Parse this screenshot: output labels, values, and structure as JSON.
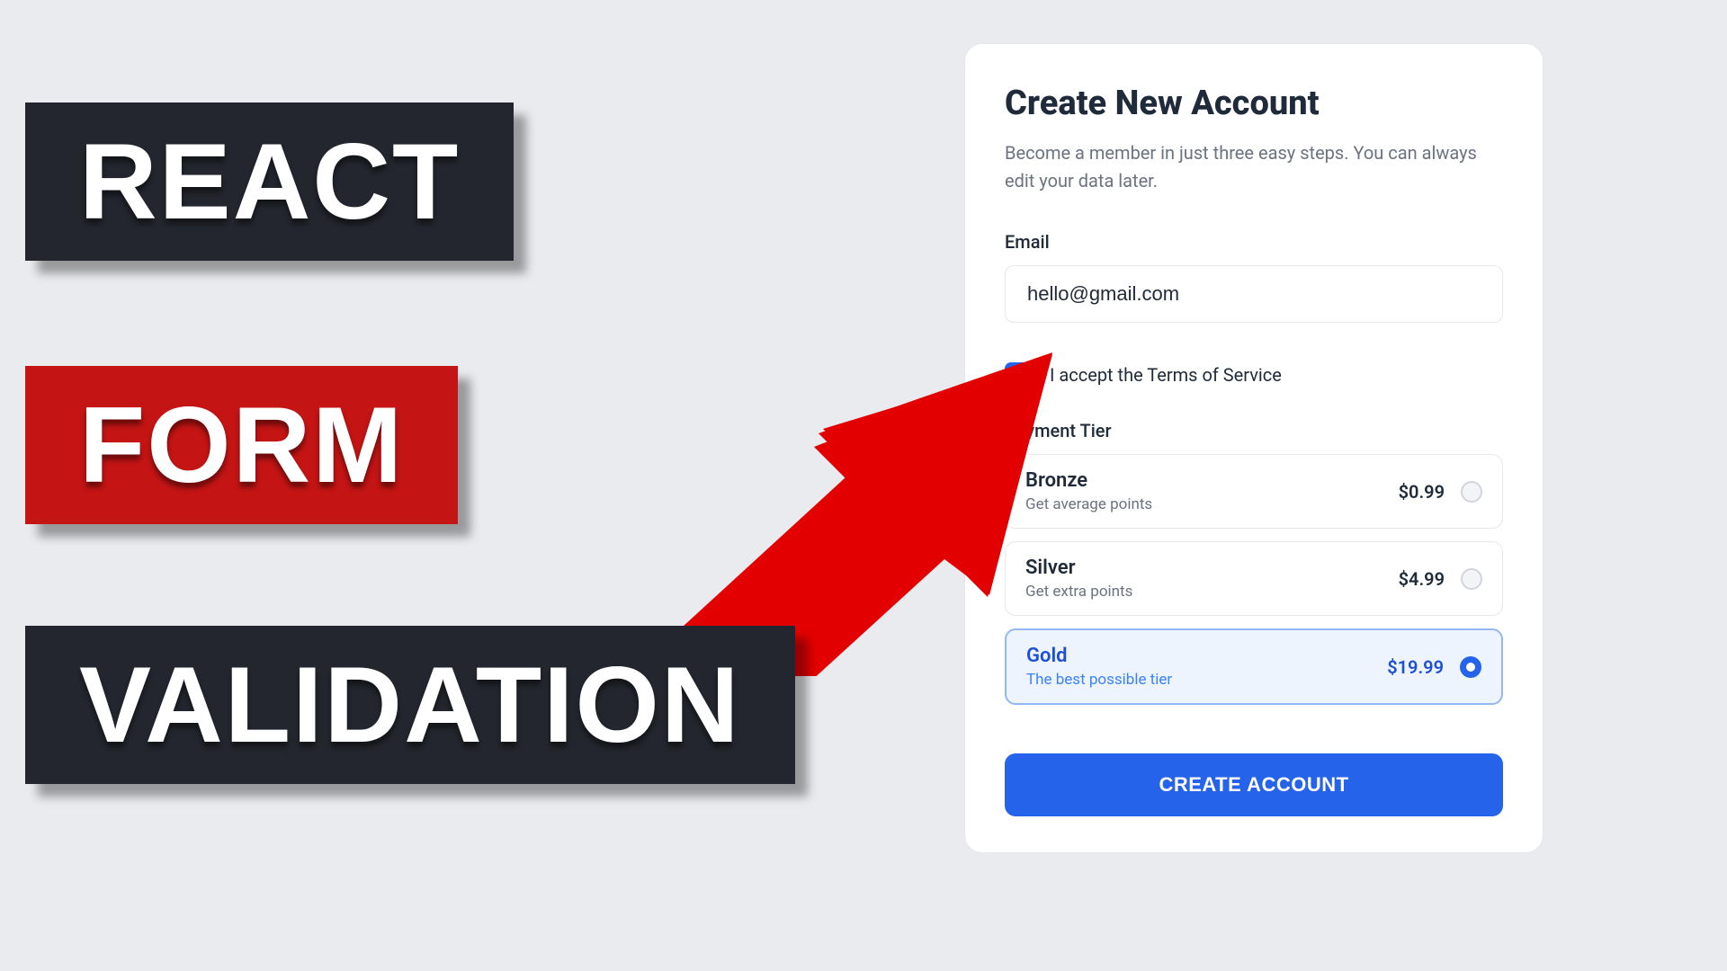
{
  "titles": {
    "react": "REACT",
    "form": "FORM",
    "validation": "VALIDATION"
  },
  "card": {
    "heading": "Create New Account",
    "subtitle": "Become a member in just three easy steps. You can always edit your data later.",
    "email": {
      "label": "Email",
      "value": "hello@gmail.com"
    },
    "terms": {
      "checked": true,
      "label": "I accept the Terms of Service"
    },
    "payment": {
      "label": "Payment Tier",
      "tiers": [
        {
          "name": "Bronze",
          "desc": "Get average points",
          "price": "$0.99",
          "selected": false
        },
        {
          "name": "Silver",
          "desc": "Get extra points",
          "price": "$4.99",
          "selected": false
        },
        {
          "name": "Gold",
          "desc": "The best possible tier",
          "price": "$19.99",
          "selected": true
        }
      ]
    },
    "submit_label": "CREATE ACCOUNT"
  },
  "colors": {
    "accent": "#2563eb",
    "dark_block": "#23262e",
    "red_block": "#c41414"
  }
}
